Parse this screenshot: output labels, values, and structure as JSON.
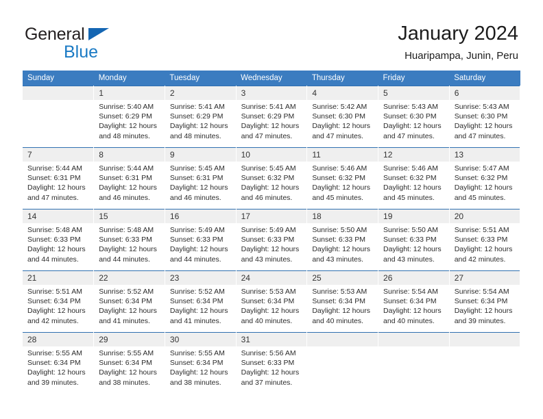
{
  "brand": {
    "name_top": "General",
    "name_bottom": "Blue",
    "triangle_color": "#1466b3",
    "text_color": "#231f20",
    "bottom_color": "#1a7ac4"
  },
  "header": {
    "title": "January 2024",
    "subtitle": "Huaripampa, Junin, Peru"
  },
  "theme": {
    "header_blue": "#3b7cc0",
    "separator_blue": "#2f6fb0",
    "daynum_band": "#efefef",
    "text": "#2b2b2b"
  },
  "weekdays": [
    "Sunday",
    "Monday",
    "Tuesday",
    "Wednesday",
    "Thursday",
    "Friday",
    "Saturday"
  ],
  "weeks": [
    [
      {
        "day": "",
        "empty": true
      },
      {
        "day": "1",
        "sunrise": "Sunrise: 5:40 AM",
        "sunset": "Sunset: 6:29 PM",
        "daylight": "Daylight: 12 hours and 48 minutes."
      },
      {
        "day": "2",
        "sunrise": "Sunrise: 5:41 AM",
        "sunset": "Sunset: 6:29 PM",
        "daylight": "Daylight: 12 hours and 48 minutes."
      },
      {
        "day": "3",
        "sunrise": "Sunrise: 5:41 AM",
        "sunset": "Sunset: 6:29 PM",
        "daylight": "Daylight: 12 hours and 47 minutes."
      },
      {
        "day": "4",
        "sunrise": "Sunrise: 5:42 AM",
        "sunset": "Sunset: 6:30 PM",
        "daylight": "Daylight: 12 hours and 47 minutes."
      },
      {
        "day": "5",
        "sunrise": "Sunrise: 5:43 AM",
        "sunset": "Sunset: 6:30 PM",
        "daylight": "Daylight: 12 hours and 47 minutes."
      },
      {
        "day": "6",
        "sunrise": "Sunrise: 5:43 AM",
        "sunset": "Sunset: 6:30 PM",
        "daylight": "Daylight: 12 hours and 47 minutes."
      }
    ],
    [
      {
        "day": "7",
        "sunrise": "Sunrise: 5:44 AM",
        "sunset": "Sunset: 6:31 PM",
        "daylight": "Daylight: 12 hours and 47 minutes."
      },
      {
        "day": "8",
        "sunrise": "Sunrise: 5:44 AM",
        "sunset": "Sunset: 6:31 PM",
        "daylight": "Daylight: 12 hours and 46 minutes."
      },
      {
        "day": "9",
        "sunrise": "Sunrise: 5:45 AM",
        "sunset": "Sunset: 6:31 PM",
        "daylight": "Daylight: 12 hours and 46 minutes."
      },
      {
        "day": "10",
        "sunrise": "Sunrise: 5:45 AM",
        "sunset": "Sunset: 6:32 PM",
        "daylight": "Daylight: 12 hours and 46 minutes."
      },
      {
        "day": "11",
        "sunrise": "Sunrise: 5:46 AM",
        "sunset": "Sunset: 6:32 PM",
        "daylight": "Daylight: 12 hours and 45 minutes."
      },
      {
        "day": "12",
        "sunrise": "Sunrise: 5:46 AM",
        "sunset": "Sunset: 6:32 PM",
        "daylight": "Daylight: 12 hours and 45 minutes."
      },
      {
        "day": "13",
        "sunrise": "Sunrise: 5:47 AM",
        "sunset": "Sunset: 6:32 PM",
        "daylight": "Daylight: 12 hours and 45 minutes."
      }
    ],
    [
      {
        "day": "14",
        "sunrise": "Sunrise: 5:48 AM",
        "sunset": "Sunset: 6:33 PM",
        "daylight": "Daylight: 12 hours and 44 minutes."
      },
      {
        "day": "15",
        "sunrise": "Sunrise: 5:48 AM",
        "sunset": "Sunset: 6:33 PM",
        "daylight": "Daylight: 12 hours and 44 minutes."
      },
      {
        "day": "16",
        "sunrise": "Sunrise: 5:49 AM",
        "sunset": "Sunset: 6:33 PM",
        "daylight": "Daylight: 12 hours and 44 minutes."
      },
      {
        "day": "17",
        "sunrise": "Sunrise: 5:49 AM",
        "sunset": "Sunset: 6:33 PM",
        "daylight": "Daylight: 12 hours and 43 minutes."
      },
      {
        "day": "18",
        "sunrise": "Sunrise: 5:50 AM",
        "sunset": "Sunset: 6:33 PM",
        "daylight": "Daylight: 12 hours and 43 minutes."
      },
      {
        "day": "19",
        "sunrise": "Sunrise: 5:50 AM",
        "sunset": "Sunset: 6:33 PM",
        "daylight": "Daylight: 12 hours and 43 minutes."
      },
      {
        "day": "20",
        "sunrise": "Sunrise: 5:51 AM",
        "sunset": "Sunset: 6:33 PM",
        "daylight": "Daylight: 12 hours and 42 minutes."
      }
    ],
    [
      {
        "day": "21",
        "sunrise": "Sunrise: 5:51 AM",
        "sunset": "Sunset: 6:34 PM",
        "daylight": "Daylight: 12 hours and 42 minutes."
      },
      {
        "day": "22",
        "sunrise": "Sunrise: 5:52 AM",
        "sunset": "Sunset: 6:34 PM",
        "daylight": "Daylight: 12 hours and 41 minutes."
      },
      {
        "day": "23",
        "sunrise": "Sunrise: 5:52 AM",
        "sunset": "Sunset: 6:34 PM",
        "daylight": "Daylight: 12 hours and 41 minutes."
      },
      {
        "day": "24",
        "sunrise": "Sunrise: 5:53 AM",
        "sunset": "Sunset: 6:34 PM",
        "daylight": "Daylight: 12 hours and 40 minutes."
      },
      {
        "day": "25",
        "sunrise": "Sunrise: 5:53 AM",
        "sunset": "Sunset: 6:34 PM",
        "daylight": "Daylight: 12 hours and 40 minutes."
      },
      {
        "day": "26",
        "sunrise": "Sunrise: 5:54 AM",
        "sunset": "Sunset: 6:34 PM",
        "daylight": "Daylight: 12 hours and 40 minutes."
      },
      {
        "day": "27",
        "sunrise": "Sunrise: 5:54 AM",
        "sunset": "Sunset: 6:34 PM",
        "daylight": "Daylight: 12 hours and 39 minutes."
      }
    ],
    [
      {
        "day": "28",
        "sunrise": "Sunrise: 5:55 AM",
        "sunset": "Sunset: 6:34 PM",
        "daylight": "Daylight: 12 hours and 39 minutes."
      },
      {
        "day": "29",
        "sunrise": "Sunrise: 5:55 AM",
        "sunset": "Sunset: 6:34 PM",
        "daylight": "Daylight: 12 hours and 38 minutes."
      },
      {
        "day": "30",
        "sunrise": "Sunrise: 5:55 AM",
        "sunset": "Sunset: 6:34 PM",
        "daylight": "Daylight: 12 hours and 38 minutes."
      },
      {
        "day": "31",
        "sunrise": "Sunrise: 5:56 AM",
        "sunset": "Sunset: 6:33 PM",
        "daylight": "Daylight: 12 hours and 37 minutes."
      },
      {
        "day": "",
        "empty": true
      },
      {
        "day": "",
        "empty": true
      },
      {
        "day": "",
        "empty": true
      }
    ]
  ]
}
